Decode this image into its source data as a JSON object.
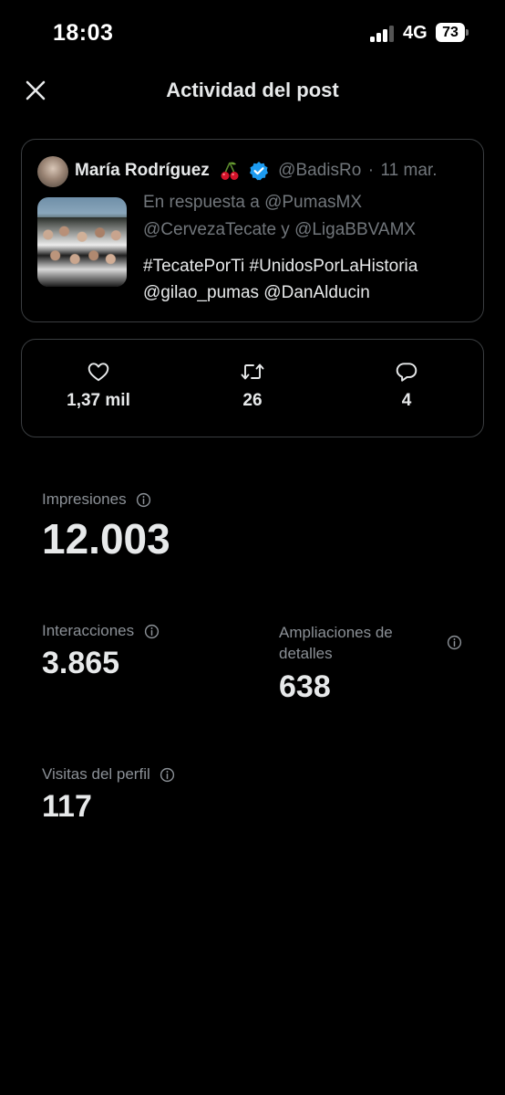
{
  "status_bar": {
    "time": "18:03",
    "network": "4G",
    "battery": "73"
  },
  "header": {
    "title": "Actividad del post",
    "close_icon": "close-icon"
  },
  "post": {
    "author_name": "María Rodríguez",
    "emoji": "cherries",
    "verified": true,
    "handle": "@BadisRo",
    "separator": "·",
    "date": "11 mar.",
    "reply_line_1": "En respuesta a @PumasMX",
    "reply_line_2": "@CervezaTecate y @LigaBBVAMX",
    "text_line_1": "#TecatePorTi #UnidosPorLaHistoria",
    "text_line_2": "@gilao_pumas @DanAlducin"
  },
  "engagement": {
    "likes": "1,37 mil",
    "reposts": "26",
    "replies": "4"
  },
  "metrics": {
    "impressions_label": "Impresiones",
    "impressions_value": "12.003",
    "interactions_label": "Interacciones",
    "interactions_value": "3.865",
    "expansions_label": "Ampliaciones de detalles",
    "expansions_value": "638",
    "profile_visits_label": "Visitas del perfil",
    "profile_visits_value": "117"
  },
  "colors": {
    "background": "#000000",
    "primary_text": "#e7e9ea",
    "secondary_text": "#71767b",
    "border": "#3a3d40",
    "verified_blue": "#1d9bf0"
  }
}
